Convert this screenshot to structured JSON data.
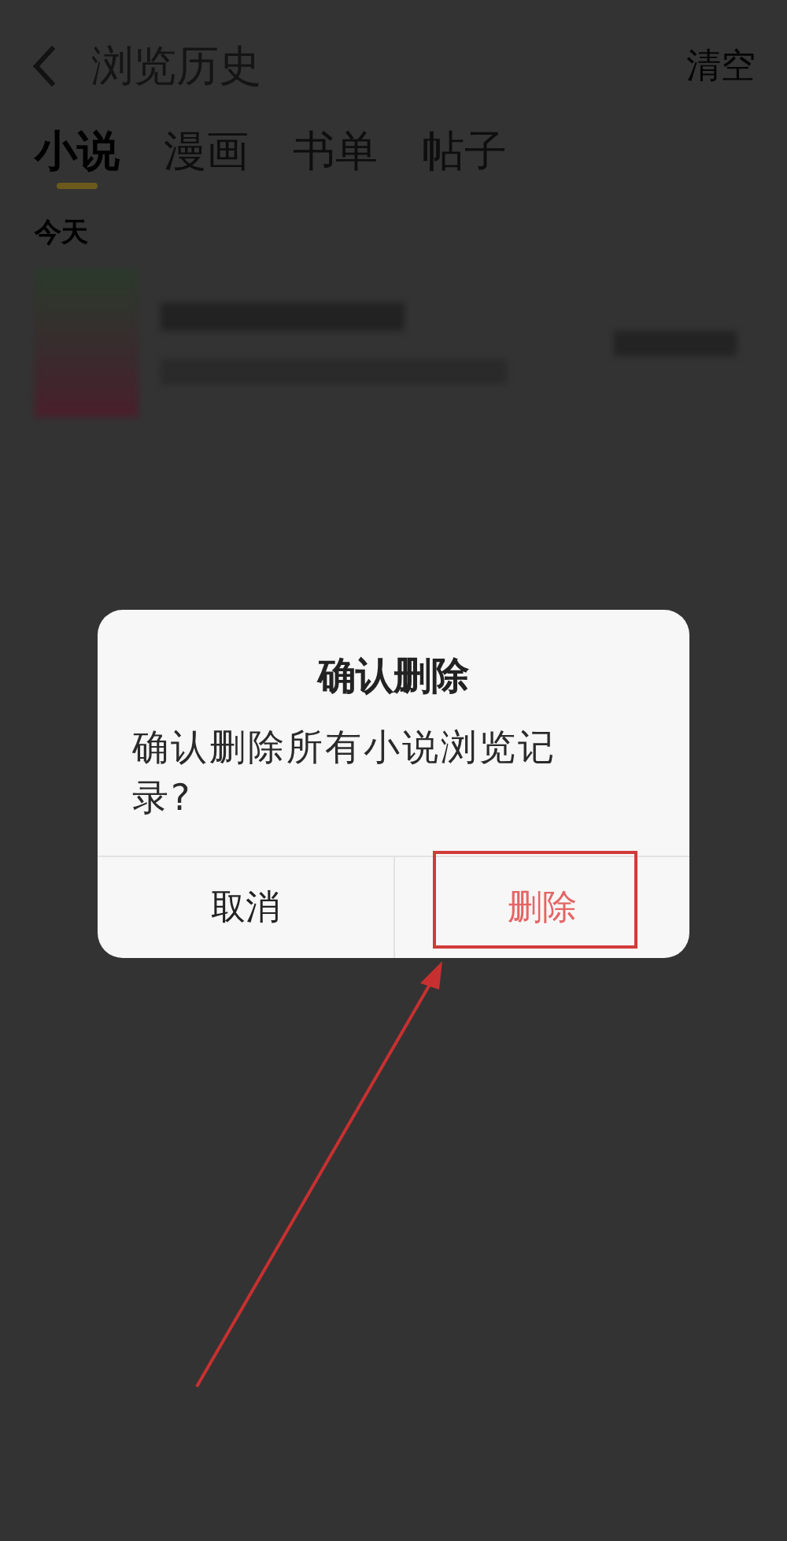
{
  "header": {
    "title": "浏览历史",
    "action": "清空"
  },
  "tabs": [
    {
      "label": "小说",
      "selected": true
    },
    {
      "label": "漫画",
      "selected": false
    },
    {
      "label": "书单",
      "selected": false
    },
    {
      "label": "帖子",
      "selected": false
    }
  ],
  "section_label": "今天",
  "dialog": {
    "title": "确认删除",
    "message": "确认删除所有小说浏览记录?",
    "buttons": [
      {
        "label": "取消",
        "kind": "cancel",
        "highlighted": false
      },
      {
        "label": "删除",
        "kind": "confirm",
        "highlighted": true
      }
    ]
  }
}
